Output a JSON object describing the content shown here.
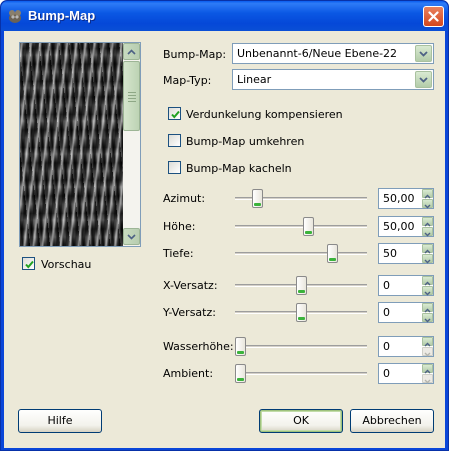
{
  "window": {
    "title": "Bump-Map",
    "app_icon": "gimp-wilber-icon",
    "close_icon": "close-icon"
  },
  "preview": {
    "label": "Vorschau",
    "checked": true,
    "scroll_up_icon": "chevron-up-icon",
    "scroll_down_icon": "chevron-down-icon"
  },
  "form": {
    "bumpmap": {
      "label": "Bump-Map:",
      "value": "Unbenannt-6/Neue Ebene-22"
    },
    "maptyp": {
      "label": "Map-Typ:",
      "value": "Linear"
    },
    "checkboxes": [
      {
        "label": "Verdunkelung kompensieren",
        "checked": true
      },
      {
        "label": "Bump-Map umkehren",
        "checked": false
      },
      {
        "label": "Bump-Map kacheln",
        "checked": false
      }
    ],
    "sliders": [
      {
        "label": "Azimut:",
        "value": "50,00",
        "level": 0.14,
        "down_enabled": true
      },
      {
        "label": "Höhe:",
        "value": "50,00",
        "level": 0.56,
        "down_enabled": true
      },
      {
        "label": "Tiefe:",
        "value": "50",
        "level": 0.76,
        "down_enabled": true
      },
      {
        "label": "X-Versatz:",
        "value": "0",
        "level": 0.5,
        "down_enabled": true
      },
      {
        "label": "Y-Versatz:",
        "value": "0",
        "level": 0.5,
        "down_enabled": true
      },
      {
        "label": "Wasserhöhe:",
        "value": "0",
        "level": 0.0,
        "down_enabled": false
      },
      {
        "label": "Ambient:",
        "value": "0",
        "level": 0.0,
        "down_enabled": false
      }
    ]
  },
  "buttons": {
    "help": "Hilfe",
    "ok": "OK",
    "cancel": "Abbrechen"
  }
}
